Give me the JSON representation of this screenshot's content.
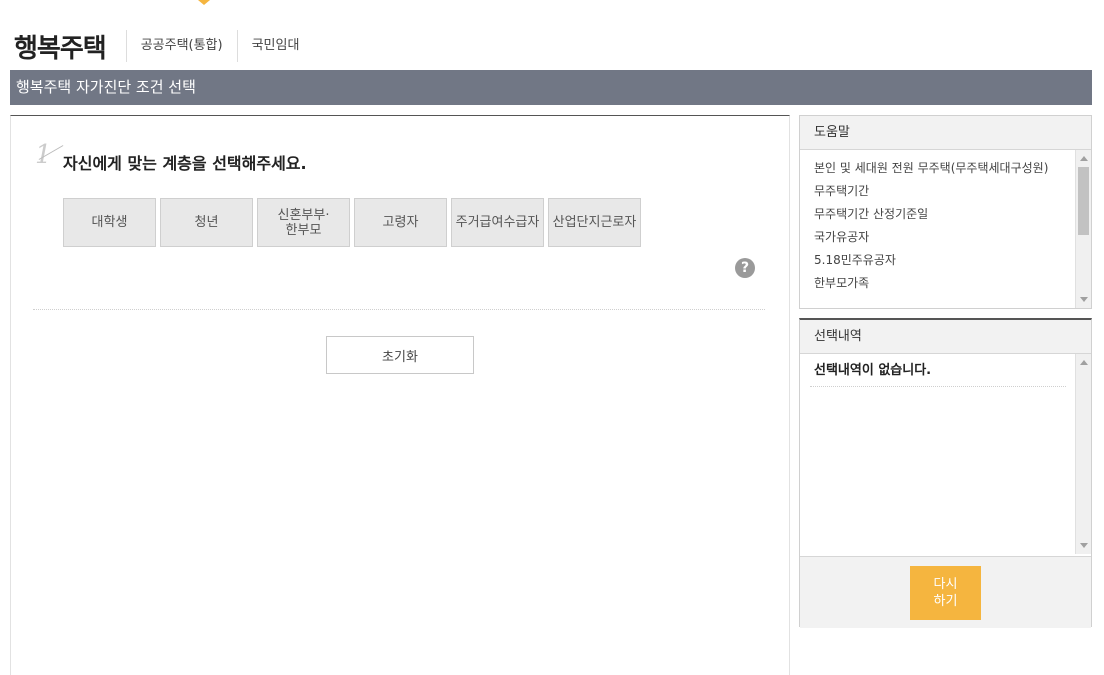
{
  "header": {
    "brand": "행복주택",
    "nav": [
      "공공주택(통합)",
      "국민임대"
    ]
  },
  "title_bar": "행복주택 자가진단 조건 선택",
  "step": {
    "number": "1",
    "title": "자신에게 맞는 계층을 선택해주세요."
  },
  "options": [
    "대학생",
    "청년",
    "신혼부부·\n한부모",
    "고령자",
    "주거급여수급자",
    "산업단지근로자"
  ],
  "help_icon": "?",
  "reset_label": "초기화",
  "help_panel": {
    "title": "도움말",
    "items": [
      "본인 및 세대원 전원 무주택(무주택세대구성원)",
      "무주택기간",
      "무주택기간 산정기준일",
      "국가유공자",
      "5.18민주유공자",
      "한부모가족"
    ]
  },
  "selection_panel": {
    "title": "선택내역",
    "empty_text": "선택내역이 없습니다.",
    "retry_label": "다시\n하기"
  },
  "colors": {
    "title_bar_bg": "#717785",
    "accent": "#f5b53f",
    "option_bg": "#e8e8e8"
  }
}
